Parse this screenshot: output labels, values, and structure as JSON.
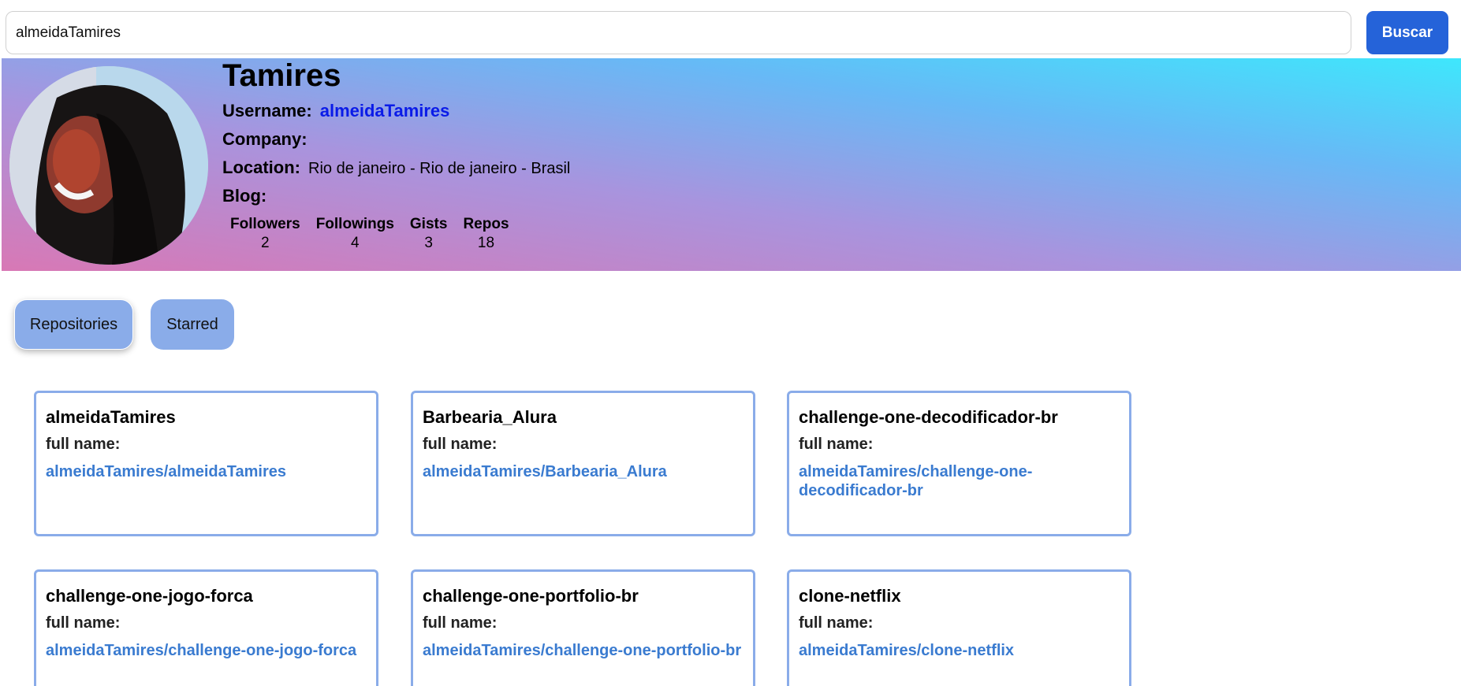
{
  "search": {
    "value": "almeidaTamires",
    "button_label": "Buscar"
  },
  "profile": {
    "name": "Tamires",
    "username_label": "Username:",
    "username": "almeidaTamires",
    "company_label": "Company:",
    "company": "",
    "location_label": "Location:",
    "location": "Rio de janeiro - Rio de janeiro - Brasil",
    "blog_label": "Blog:",
    "blog": "",
    "stats": [
      {
        "label": "Followers",
        "value": "2"
      },
      {
        "label": "Followings",
        "value": "4"
      },
      {
        "label": "Gists",
        "value": "3"
      },
      {
        "label": "Repos",
        "value": "18"
      }
    ],
    "banner_colors": [
      "#d878b5",
      "#a894de",
      "#67b9f6",
      "#3ee7fc"
    ]
  },
  "tabs": [
    {
      "label": "Repositories",
      "active": true
    },
    {
      "label": "Starred",
      "active": false
    }
  ],
  "repos": [
    {
      "name": "almeidaTamires",
      "full_name_label": "full name:",
      "full_name": "almeidaTamires/almeidaTamires"
    },
    {
      "name": "Barbearia_Alura",
      "full_name_label": "full name:",
      "full_name": "almeidaTamires/Barbearia_Alura"
    },
    {
      "name": "challenge-one-decodificador-br",
      "full_name_label": "full name:",
      "full_name": "almeidaTamires/challenge-one-decodificador-br"
    },
    {
      "name": "challenge-one-jogo-forca",
      "full_name_label": "full name:",
      "full_name": "almeidaTamires/challenge-one-jogo-forca"
    },
    {
      "name": "challenge-one-portfolio-br",
      "full_name_label": "full name:",
      "full_name": "almeidaTamires/challenge-one-portfolio-br"
    },
    {
      "name": "clone-netflix",
      "full_name_label": "full name:",
      "full_name": "almeidaTamires/clone-netflix"
    }
  ],
  "colors": {
    "accent": "#2563d9",
    "link": "#3a7bd0",
    "username": "#0a1be8",
    "tab_bg": "#8aace9",
    "card_border": "#8aace9"
  }
}
